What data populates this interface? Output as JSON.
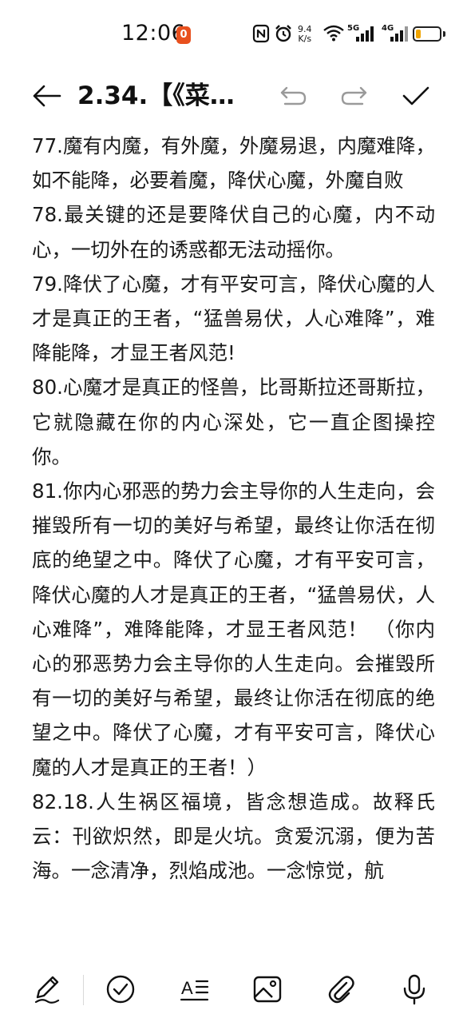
{
  "status_bar": {
    "time": "12:06",
    "notification_badge": "0",
    "net_speed_value": "9.4",
    "net_speed_unit": "K/s",
    "signal_1_label": "5G",
    "signal_2_label": "4G",
    "battery_level": 0.2,
    "battery_color": "#f0a400"
  },
  "toolbar": {
    "back_icon": "arrow-left-icon",
    "title": "2.34.【《菜…",
    "undo_icon": "undo-icon",
    "redo_icon": "redo-icon",
    "done_icon": "checkmark-icon"
  },
  "content": {
    "paragraphs": [
      "77.魔有内魔，有外魔，外魔易退，内魔难降，如不能降，必要着魔，降伏心魔，外魔自败",
      "78.最关键的还是要降伏自己的心魔，内不动心，一切外在的诱惑都无法动摇你。",
      "79.降伏了心魔，才有平安可言，降伏心魔的人才是真正的王者，“猛兽易伏，人心难降”，难降能降，才显王者风范!",
      "80.心魔才是真正的怪兽，比哥斯拉还哥斯拉，它就隐藏在你的内心深处，它一直企图操控你。",
      "81.你内心邪恶的势力会主导你的人生走向，会摧毁所有一切的美好与希望，最终让你活在彻底的绝望之中。降伏了心魔，才有平安可言，降伏心魔的人才是真正的王者，“猛兽易伏，人心难降”，难降能降，才显王者风范！ （你内心的邪恶势力会主导你的人生走向。会摧毁所有一切的美好与希望，最终让你活在彻底的绝望之中。降伏了心魔，才有平安可言，降伏心魔的人才是真正的王者！）",
      "82.18.人生祸区福境，皆念想造成。故释氏云：刊欲炽然，即是火坑。贪爱沉溺，便为苦海。一念清净，烈焰成池。一念惊觉，航"
    ]
  },
  "bottom_bar": {
    "icons": [
      "handwriting-pen-icon",
      "checklist-icon",
      "text-format-icon",
      "image-icon",
      "attachment-icon",
      "microphone-icon"
    ],
    "format_label": "A"
  }
}
